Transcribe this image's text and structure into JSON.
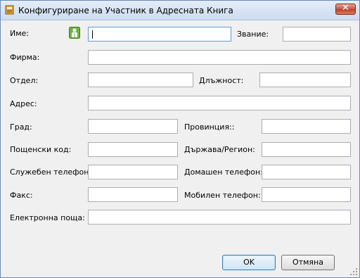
{
  "window": {
    "title": "Конфигуриране на Участник в Адресната Книга",
    "close_glyph": "✕"
  },
  "icons": {
    "title": "address-book-icon",
    "contact": "person-icon",
    "close": "close-icon"
  },
  "colors": {
    "contact_icon": "#6db33f",
    "focus_border": "#5a9be0"
  },
  "labels": {
    "name": "Име:",
    "title": "Звание:",
    "company": "Фирма:",
    "department": "Отдел:",
    "position": "Длъжност:",
    "address": "Адрес:",
    "city": "Град:",
    "province": "Провинция::",
    "postal_code": "Пощенски код:",
    "country": "Държава/Регион:",
    "work_phone": "Служебен телефон:",
    "home_phone": "Домашен телефон:",
    "fax": "Факс:",
    "mobile_phone": "Мобилен телефон:",
    "email": "Електронна поща:"
  },
  "fields": {
    "name": "",
    "title": "",
    "company": "",
    "department": "",
    "position": "",
    "address": "",
    "city": "",
    "province": "",
    "postal_code": "",
    "country": "",
    "work_phone": "",
    "home_phone": "",
    "fax": "",
    "mobile_phone": "",
    "email": ""
  },
  "buttons": {
    "ok": "OK",
    "cancel": "Отмяна"
  }
}
